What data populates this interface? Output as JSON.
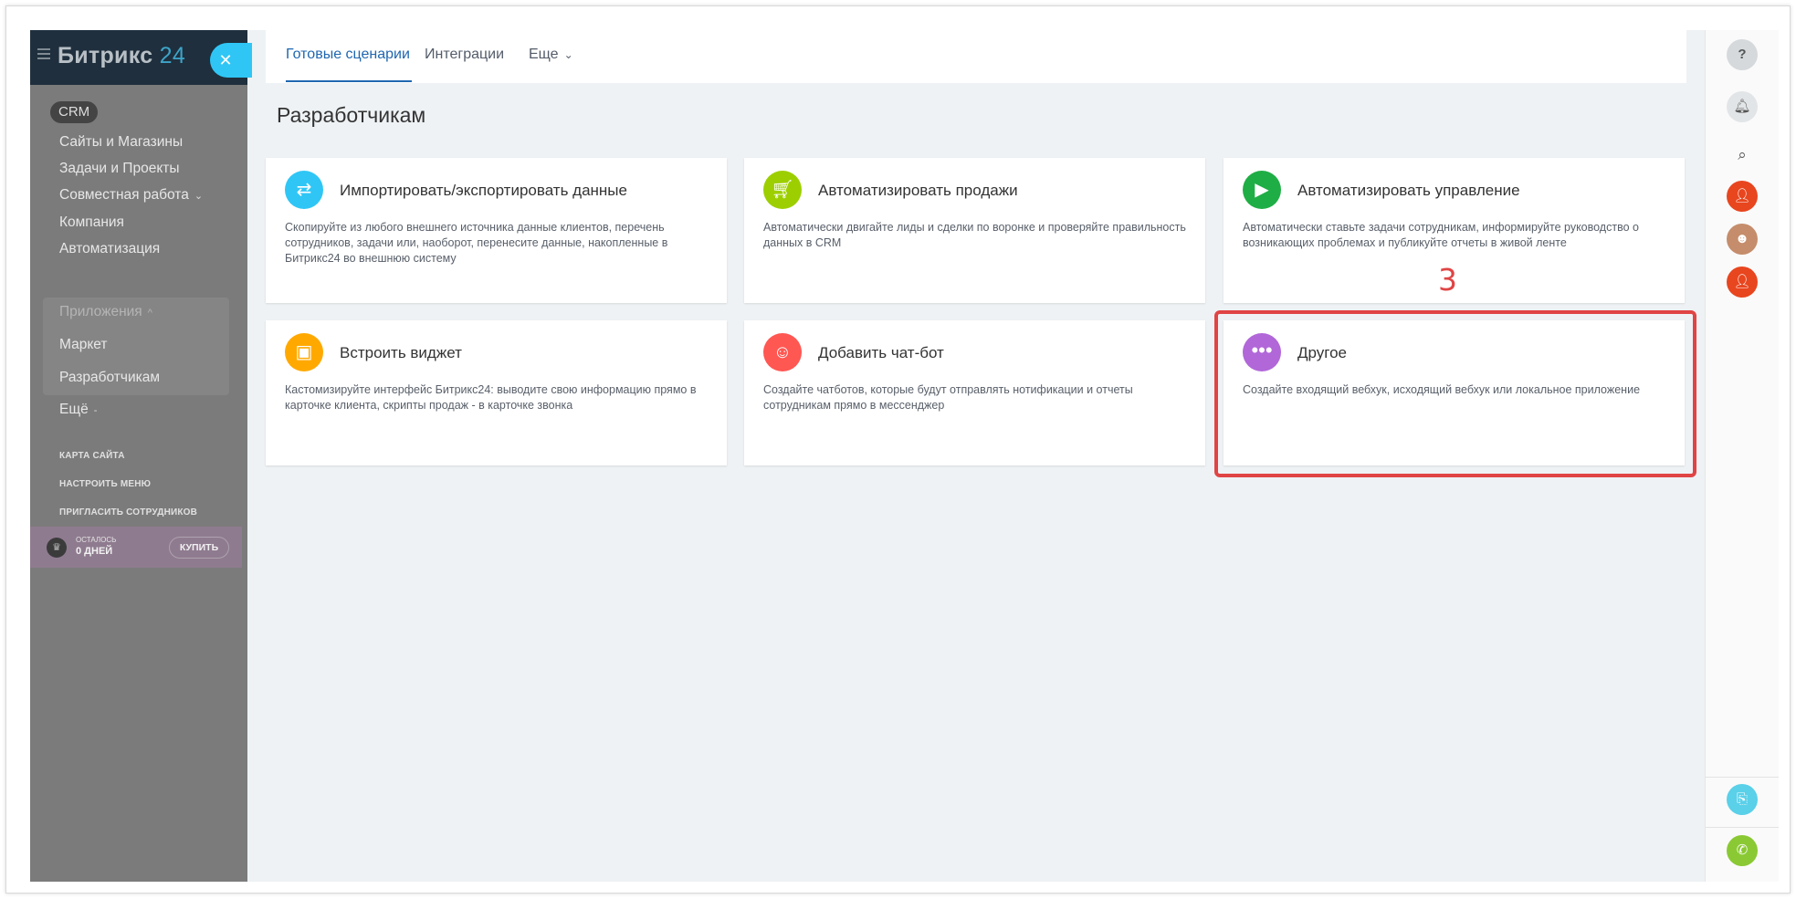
{
  "sidebar": {
    "logo_main": "Битрикс",
    "logo_num": "24",
    "crm_label": "CRM",
    "items": [
      {
        "label": "Сайты и Магазины"
      },
      {
        "label": "Задачи и Проекты"
      },
      {
        "label": "Совместная работа"
      },
      {
        "label": "Компания"
      },
      {
        "label": "Автоматизация"
      },
      {
        "label": "Приложения"
      },
      {
        "label": "Маркет"
      },
      {
        "label": "Разработчикам"
      },
      {
        "label": "Ещё"
      }
    ],
    "links": {
      "sitemap": "КАРТА САЙТА",
      "setup_menu": "НАСТРОИТЬ МЕНЮ",
      "invite": "ПРИГЛАСИТЬ СОТРУДНИКОВ"
    },
    "trial": {
      "line1": "ОСТАЛОСЬ",
      "line2": "0 ДНЕЙ",
      "buy_label": "КУПИТЬ"
    }
  },
  "tabs": [
    {
      "label": "Готовые сценарии",
      "active": true
    },
    {
      "label": "Интеграции",
      "active": false
    },
    {
      "label": "Еще",
      "active": false
    }
  ],
  "page": {
    "title": "Разработчикам",
    "marker": "3"
  },
  "cards": [
    {
      "title": "Импортировать/экспортировать данные",
      "desc": "Скопируйте из любого внешнего источника данные клиентов, перечень сотрудников, задачи или, наоборот, перенесите данные, накопленные в Битрикс24 во внешнюю систему",
      "icon": "arrows-swap-icon",
      "color": "#2fc6f6"
    },
    {
      "title": "Автоматизировать продажи",
      "desc": "Автоматически двигайте лиды и сделки по воронке и проверяйте правильность данных в CRM",
      "icon": "cart-icon",
      "color": "#9dcf00"
    },
    {
      "title": "Автоматизировать управление",
      "desc": "Автоматически ставьте задачи сотрудникам, информируйте руководство о возникающих проблемах и публикуйте отчеты в живой ленте",
      "icon": "play-icon",
      "color": "#1fae45"
    },
    {
      "title": "Встроить виджет",
      "desc": "Кастомизируйте интерфейс Битрикс24: выводите свою информацию прямо в карточке клиента, скрипты продаж - в карточке звонка",
      "icon": "widget-icon",
      "color": "#ffa900"
    },
    {
      "title": "Добавить чат-бот",
      "desc": "Создайте чатботов, которые будут отправлять нотификации и отчеты сотрудникам прямо в мессенджер",
      "icon": "robot-icon",
      "color": "#ff5752"
    },
    {
      "title": "Другое",
      "desc": "Создайте входящий вебхук, исходящий вебхук или локальное приложение",
      "icon": "ellipsis-icon",
      "color": "#b167d8"
    }
  ],
  "colors": {
    "accent": "#2067b0",
    "highlight": "#e04444",
    "user_avatar": "#e8461f"
  }
}
